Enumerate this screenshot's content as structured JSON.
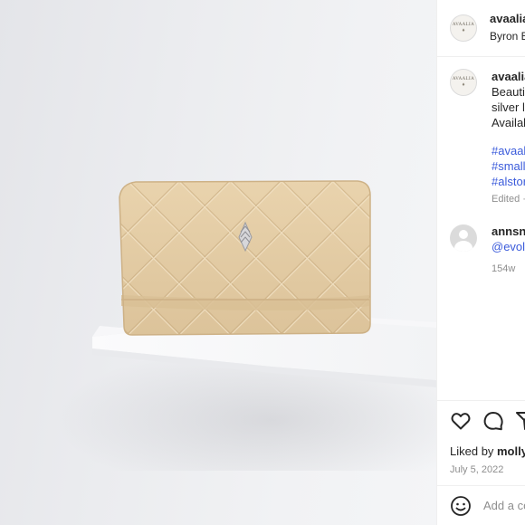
{
  "post": {
    "author_handle": "avaalia",
    "location": "Byron B",
    "avatar_brand": "AVAALIA",
    "avatar_mark": "♦",
    "caption_author": "avaalia",
    "caption_lines": [
      "Beautif",
      "silver l",
      "Availab"
    ],
    "hashtags": [
      "#avaal",
      "#small",
      "#alstor"
    ],
    "edited_label": "Edited ·"
  },
  "comment": {
    "author": "annsnl",
    "mention": "@evolv",
    "age": "154w"
  },
  "actions": {
    "liked_prefix": "Liked by",
    "liked_user": "molly",
    "date": "July 5, 2022",
    "add_comment_placeholder": "Add a co"
  },
  "icons": {
    "like": "heart-icon",
    "comment": "comment-icon",
    "share": "share-icon",
    "emoji": "emoji-icon"
  },
  "colors": {
    "link": "#3b5bdb",
    "wallet": "#e3cba3",
    "background": "#ebecef"
  }
}
